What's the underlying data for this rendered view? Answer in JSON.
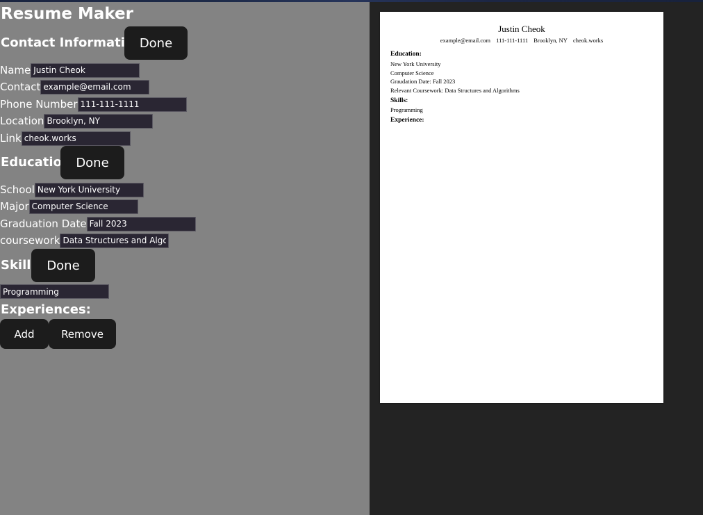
{
  "app": {
    "title": "Resume Maker"
  },
  "contact": {
    "header": "Contact Information",
    "done_label": "Done",
    "fields": {
      "name": {
        "label": "Name",
        "value": "Justin Cheok"
      },
      "email": {
        "label": "Contact",
        "value": "example@email.com"
      },
      "phone": {
        "label": "Phone Number",
        "value": "111-111-1111"
      },
      "location": {
        "label": "Location",
        "value": "Brooklyn, NY"
      },
      "link": {
        "label": "Link",
        "value": "cheok.works"
      }
    }
  },
  "education": {
    "header": "Education",
    "done_label": "Done",
    "fields": {
      "school": {
        "label": "School",
        "value": "New York University"
      },
      "major": {
        "label": "Major",
        "value": "Computer Science"
      },
      "graduation": {
        "label": "Graduation Date",
        "value": "Fall 2023"
      },
      "coursework": {
        "label": "coursework",
        "value": "Data Structures and Algorithms"
      }
    }
  },
  "skills": {
    "header": "Skills",
    "done_label": "Done",
    "value": "Programming"
  },
  "experiences": {
    "header": "Experiences:",
    "add_label": "Add",
    "remove_label": "Remove"
  },
  "resume": {
    "name": "Justin Cheok",
    "email": "example@email.com",
    "phone": "111-111-1111",
    "location": "Brooklyn, NY",
    "link": "cheok.works",
    "education_title": "Education:",
    "school": "New York University",
    "major": "Computer Science",
    "graduation": "Graudation Date: Fall 2023",
    "coursework": "Relevant Coursework: Data Structures and Algorithms",
    "skills_title": "Skills:",
    "skills": "Programming",
    "experience_title": "Experience:"
  },
  "colors": {
    "left_panel_bg": "#838383",
    "right_panel_bg": "#232323",
    "button_bg": "#1c1c1c",
    "input_bg": "#2a2633"
  }
}
